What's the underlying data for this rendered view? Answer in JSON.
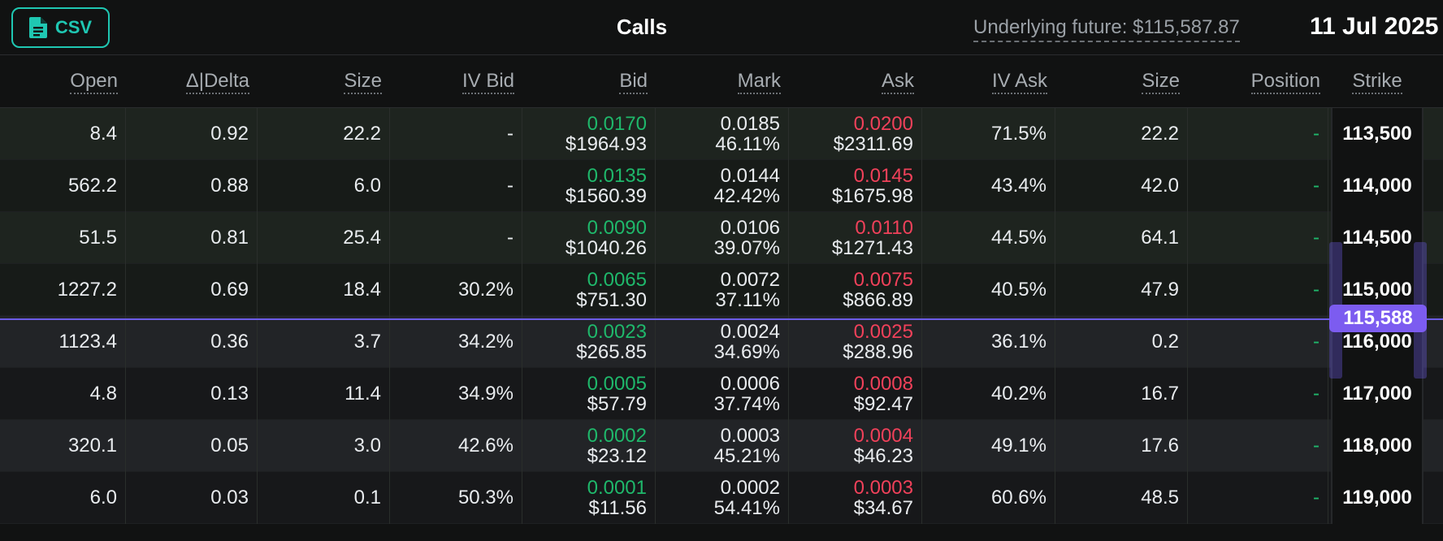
{
  "toolbar": {
    "csv_label": "CSV",
    "title": "Calls",
    "underlying": "Underlying future: $115,587.87",
    "date": "11 Jul 2025"
  },
  "columns": [
    "Open",
    "Δ|Delta",
    "Size",
    "IV Bid",
    "Bid",
    "Mark",
    "Ask",
    "IV Ask",
    "Size",
    "Position",
    "Strike"
  ],
  "marker": {
    "value": "115,588"
  },
  "rows": [
    {
      "open": "8.4",
      "delta": "0.92",
      "bid_size": "22.2",
      "iv_bid": "-",
      "bid": "0.0170",
      "bid_usd": "$1964.93",
      "mark": "0.0185",
      "mark_iv": "46.11%",
      "ask": "0.0200",
      "ask_usd": "$2311.69",
      "iv_ask": "71.5%",
      "ask_size": "22.2",
      "position": "-",
      "strike": "113,500"
    },
    {
      "open": "562.2",
      "delta": "0.88",
      "bid_size": "6.0",
      "iv_bid": "-",
      "bid": "0.0135",
      "bid_usd": "$1560.39",
      "mark": "0.0144",
      "mark_iv": "42.42%",
      "ask": "0.0145",
      "ask_usd": "$1675.98",
      "iv_ask": "43.4%",
      "ask_size": "42.0",
      "position": "-",
      "strike": "114,000"
    },
    {
      "open": "51.5",
      "delta": "0.81",
      "bid_size": "25.4",
      "iv_bid": "-",
      "bid": "0.0090",
      "bid_usd": "$1040.26",
      "mark": "0.0106",
      "mark_iv": "39.07%",
      "ask": "0.0110",
      "ask_usd": "$1271.43",
      "iv_ask": "44.5%",
      "ask_size": "64.1",
      "position": "-",
      "strike": "114,500"
    },
    {
      "open": "1227.2",
      "delta": "0.69",
      "bid_size": "18.4",
      "iv_bid": "30.2%",
      "bid": "0.0065",
      "bid_usd": "$751.30",
      "mark": "0.0072",
      "mark_iv": "37.11%",
      "ask": "0.0075",
      "ask_usd": "$866.89",
      "iv_ask": "40.5%",
      "ask_size": "47.9",
      "position": "-",
      "strike": "115,000"
    },
    {
      "open": "1123.4",
      "delta": "0.36",
      "bid_size": "3.7",
      "iv_bid": "34.2%",
      "bid": "0.0023",
      "bid_usd": "$265.85",
      "mark": "0.0024",
      "mark_iv": "34.69%",
      "ask": "0.0025",
      "ask_usd": "$288.96",
      "iv_ask": "36.1%",
      "ask_size": "0.2",
      "position": "-",
      "strike": "116,000"
    },
    {
      "open": "4.8",
      "delta": "0.13",
      "bid_size": "11.4",
      "iv_bid": "34.9%",
      "bid": "0.0005",
      "bid_usd": "$57.79",
      "mark": "0.0006",
      "mark_iv": "37.74%",
      "ask": "0.0008",
      "ask_usd": "$92.47",
      "iv_ask": "40.2%",
      "ask_size": "16.7",
      "position": "-",
      "strike": "117,000"
    },
    {
      "open": "320.1",
      "delta": "0.05",
      "bid_size": "3.0",
      "iv_bid": "42.6%",
      "bid": "0.0002",
      "bid_usd": "$23.12",
      "mark": "0.0003",
      "mark_iv": "45.21%",
      "ask": "0.0004",
      "ask_usd": "$46.23",
      "iv_ask": "49.1%",
      "ask_size": "17.6",
      "position": "-",
      "strike": "118,000"
    },
    {
      "open": "6.0",
      "delta": "0.03",
      "bid_size": "0.1",
      "iv_bid": "50.3%",
      "bid": "0.0001",
      "bid_usd": "$11.56",
      "mark": "0.0002",
      "mark_iv": "54.41%",
      "ask": "0.0003",
      "ask_usd": "$34.67",
      "iv_ask": "60.6%",
      "ask_size": "48.5",
      "position": "-",
      "strike": "119,000"
    }
  ],
  "colors": {
    "accent": "#1fc7b2",
    "bid": "#1fb86b",
    "ask": "#f0415a",
    "marker": "#7c5cf0"
  },
  "icons": {
    "csv": "file-icon"
  }
}
